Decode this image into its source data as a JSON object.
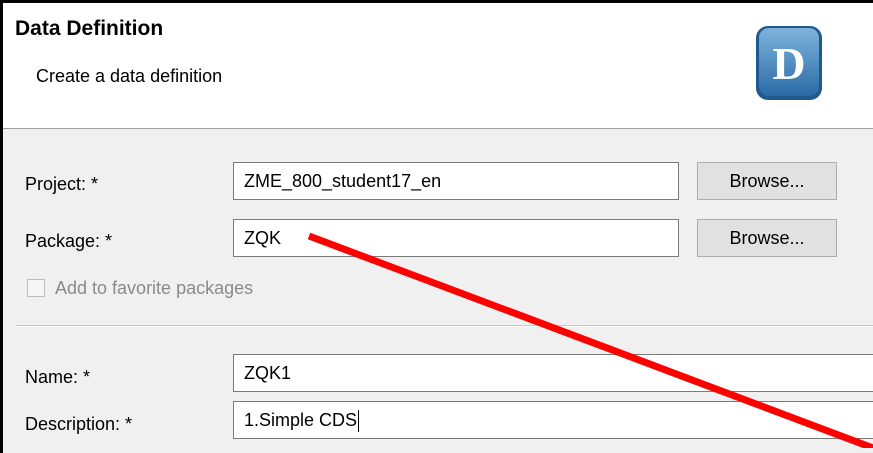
{
  "header": {
    "title": "Data Definition",
    "subtitle": "Create a data definition",
    "logo_letter": "D"
  },
  "form": {
    "project": {
      "label": "Project: *",
      "value": "ZME_800_student17_en",
      "browse_label": "Browse..."
    },
    "package": {
      "label": "Package: *",
      "value": "ZQK",
      "browse_label": "Browse..."
    },
    "favorite": {
      "label": "Add to favorite packages",
      "checked": false,
      "enabled": false
    },
    "name": {
      "label": "Name: *",
      "value": "ZQK1"
    },
    "description": {
      "label": "Description: *",
      "value": "1.Simple CDS"
    }
  },
  "annotation": {
    "color": "#ff0000"
  }
}
